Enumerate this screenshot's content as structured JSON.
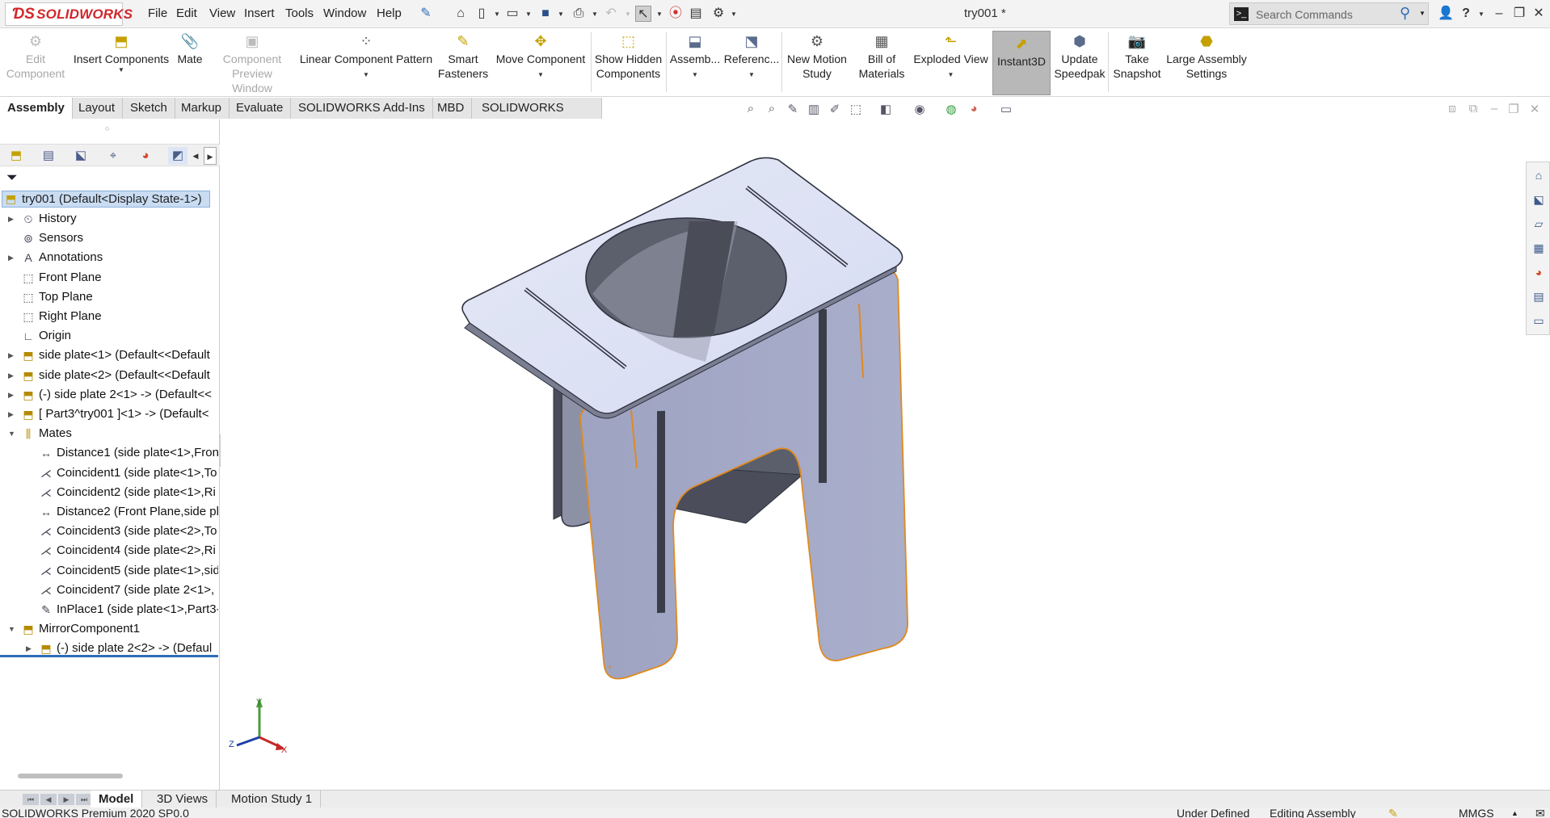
{
  "app": {
    "brand": "SOLIDWORKS",
    "doc_title": "try001 *"
  },
  "menu": [
    "File",
    "Edit",
    "View",
    "Insert",
    "Tools",
    "Window",
    "Help"
  ],
  "search": {
    "placeholder": "Search Commands"
  },
  "commands": {
    "edit_component": [
      "Edit",
      "Component"
    ],
    "insert_components": "Insert Components",
    "mate": "Mate",
    "component_preview": [
      "Component",
      "Preview Window"
    ],
    "linear_pattern": "Linear Component Pattern",
    "smart_fasteners": [
      "Smart",
      "Fasteners"
    ],
    "move_component": "Move Component",
    "show_hidden": [
      "Show Hidden",
      "Components"
    ],
    "assembly": "Assemb...",
    "reference": "Referenc...",
    "motion_study": [
      "New Motion",
      "Study"
    ],
    "bom": [
      "Bill of",
      "Materials"
    ],
    "exploded_view": "Exploded View",
    "instant3d": "Instant3D",
    "speedpak": [
      "Update",
      "Speedpak"
    ],
    "snapshot": [
      "Take",
      "Snapshot"
    ],
    "large_assembly": [
      "Large Assembly",
      "Settings"
    ]
  },
  "tabs": [
    "Assembly",
    "Layout",
    "Sketch",
    "Markup",
    "Evaluate",
    "SOLIDWORKS Add-Ins",
    "MBD",
    "SOLIDWORKS CAM"
  ],
  "tree": {
    "root": "try001  (Default<Display State-1>)",
    "items": [
      {
        "label": "History",
        "icon": "history-icon",
        "expand": true
      },
      {
        "label": "Sensors",
        "icon": "sensor-icon",
        "expand": false
      },
      {
        "label": "Annotations",
        "icon": "annotations-icon",
        "expand": true
      },
      {
        "label": "Front Plane",
        "icon": "plane-icon",
        "expand": false
      },
      {
        "label": "Top Plane",
        "icon": "plane-icon",
        "expand": false
      },
      {
        "label": "Right Plane",
        "icon": "plane-icon",
        "expand": false
      },
      {
        "label": "Origin",
        "icon": "origin-icon",
        "expand": false
      },
      {
        "label": "side plate<1> (Default<<Default",
        "icon": "part-icon",
        "expand": true
      },
      {
        "label": "side plate<2> (Default<<Default",
        "icon": "part-icon",
        "expand": true
      },
      {
        "label": "(-) side plate 2<1> -> (Default<<",
        "icon": "part-icon",
        "expand": true
      },
      {
        "label": "[ Part3^try001 ]<1> -> (Default<",
        "icon": "part-icon",
        "expand": true
      },
      {
        "label": "Mates",
        "icon": "mates-icon",
        "expand": true,
        "open": true
      }
    ],
    "mates": [
      {
        "label": "Distance1 (side plate<1>,Fron",
        "icon": "distance-mate-icon"
      },
      {
        "label": "Coincident1 (side plate<1>,To",
        "icon": "coincident-mate-icon"
      },
      {
        "label": "Coincident2 (side plate<1>,Ri",
        "icon": "coincident-mate-icon"
      },
      {
        "label": "Distance2 (Front Plane,side pla",
        "icon": "distance-mate-icon"
      },
      {
        "label": "Coincident3 (side plate<2>,To",
        "icon": "coincident-mate-icon"
      },
      {
        "label": "Coincident4 (side plate<2>,Ri",
        "icon": "coincident-mate-icon"
      },
      {
        "label": "Coincident5 (side plate<1>,sid",
        "icon": "coincident-mate-icon"
      },
      {
        "label": "Coincident7 (side plate 2<1>,",
        "icon": "coincident-mate-icon"
      },
      {
        "label": "InPlace1 (side plate<1>,Part3-",
        "icon": "inplace-mate-icon"
      }
    ],
    "mirror": {
      "label": "MirrorComponent1",
      "child": "(-) side plate 2<2> -> (Defaul"
    }
  },
  "bottom_tabs": [
    "Model",
    "3D Views",
    "Motion Study 1"
  ],
  "status": {
    "left": "SOLIDWORKS Premium 2020 SP0.0",
    "state": "Under Defined",
    "mode": "Editing Assembly",
    "units": "MMGS"
  },
  "triad": {
    "x": "X",
    "y": "Y",
    "z": "Z"
  },
  "colors": {
    "accent": "#2e6eb5",
    "selection": "#c9dcf2",
    "brand": "#d0272c",
    "edge_highlight": "#e08a1e"
  }
}
